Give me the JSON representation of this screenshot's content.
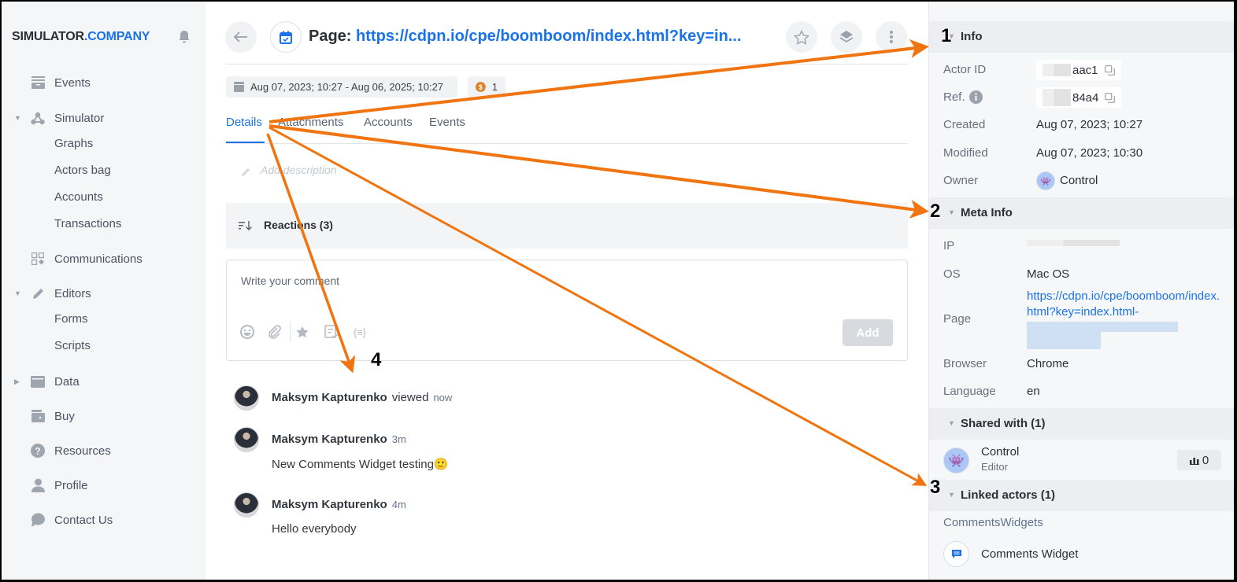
{
  "brand": {
    "name": "SIMULATOR",
    "suffix": ".COMPANY"
  },
  "colors": {
    "accent": "#1a73e8",
    "annotation_arrow": "#f07410"
  },
  "sidebar": {
    "items": [
      {
        "label": "Events",
        "icon": "archive-icon"
      },
      {
        "label": "Simulator",
        "icon": "graph-icon",
        "expanded": true,
        "children": [
          "Graphs",
          "Actors bag",
          "Accounts",
          "Transactions"
        ]
      },
      {
        "label": "Communications",
        "icon": "widgets-icon"
      },
      {
        "label": "Editors",
        "icon": "pencil-icon",
        "expanded": true,
        "children": [
          "Forms",
          "Scripts"
        ]
      },
      {
        "label": "Data",
        "icon": "folder-icon",
        "expanded": false
      },
      {
        "label": "Buy",
        "icon": "wallet-icon"
      },
      {
        "label": "Resources",
        "icon": "help-icon"
      },
      {
        "label": "Profile",
        "icon": "user-icon"
      },
      {
        "label": "Contact Us",
        "icon": "chat-icon"
      }
    ]
  },
  "header": {
    "title_prefix": "Page:",
    "title_url": "https://cdpn.io/cpe/boomboom/index.html?key=in...",
    "date_range": "Aug 07, 2023; 10:27 - Aug 06, 2025; 10:27",
    "coin_count": "1"
  },
  "tabs": [
    {
      "label": "Details",
      "active": true
    },
    {
      "label": "Attachments"
    },
    {
      "label": "Accounts"
    },
    {
      "label": "Events"
    }
  ],
  "description_placeholder": "Add description",
  "reactions": {
    "title": "Reactions (3)",
    "comment_placeholder": "Write your comment",
    "add_label": "Add"
  },
  "feed": [
    {
      "name": "Maksym Kapturenko",
      "action": "viewed",
      "time": "now",
      "text": ""
    },
    {
      "name": "Maksym Kapturenko",
      "action": "",
      "time": "3m",
      "text": "New Comments Widget testing🙂"
    },
    {
      "name": "Maksym Kapturenko",
      "action": "",
      "time": "4m",
      "text": "Hello everybody"
    }
  ],
  "info": {
    "title": "Info",
    "actor_id_label": "Actor ID",
    "actor_id_value": "aac1",
    "ref_label": "Ref.",
    "ref_value": "84a4",
    "created_label": "Created",
    "created_value": "Aug 07, 2023; 10:27",
    "modified_label": "Modified",
    "modified_value": "Aug 07, 2023; 10:30",
    "owner_label": "Owner",
    "owner_value": "Control"
  },
  "meta": {
    "title": "Meta Info",
    "ip_label": "IP",
    "os_label": "OS",
    "os_value": "Mac OS",
    "page_label": "Page",
    "page_value": "https://cdpn.io/cpe/boomboom/index.html?key=index.html-",
    "browser_label": "Browser",
    "browser_value": "Chrome",
    "language_label": "Language",
    "language_value": "en"
  },
  "shared": {
    "title": "Shared with (1)",
    "user": "Control",
    "role": "Editor",
    "stat": "0"
  },
  "linked": {
    "title": "Linked actors (1)",
    "group": "CommentsWidgets",
    "item": "Comments Widget"
  },
  "annotations": [
    "1",
    "2",
    "3",
    "4"
  ]
}
